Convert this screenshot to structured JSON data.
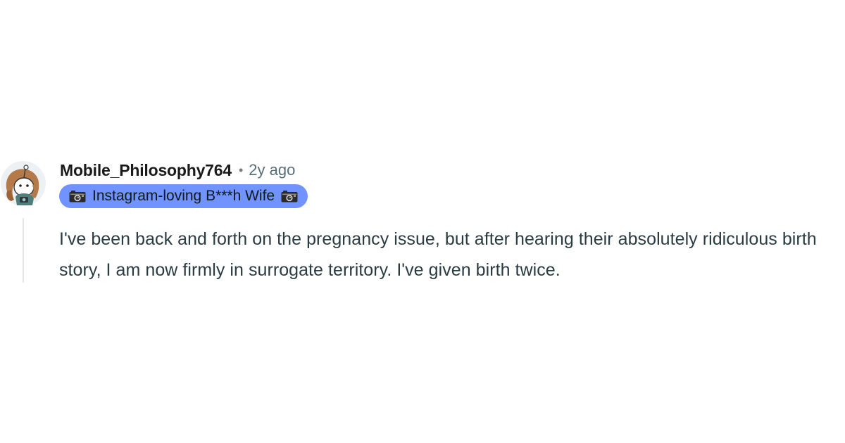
{
  "comment": {
    "username": "Mobile_Philosophy764",
    "separator": "•",
    "timestamp": "2y ago",
    "flair": {
      "text": "Instagram-loving B***h Wife",
      "icon": "camera-emoji",
      "background": "#7193ff"
    },
    "avatar": {
      "icon": "snoo-avatar"
    },
    "text": "I've been back and forth on the pregnancy issue, but after hearing their absolutely ridiculous birth story, I am now firmly in surrogate territory. I've given birth twice."
  }
}
